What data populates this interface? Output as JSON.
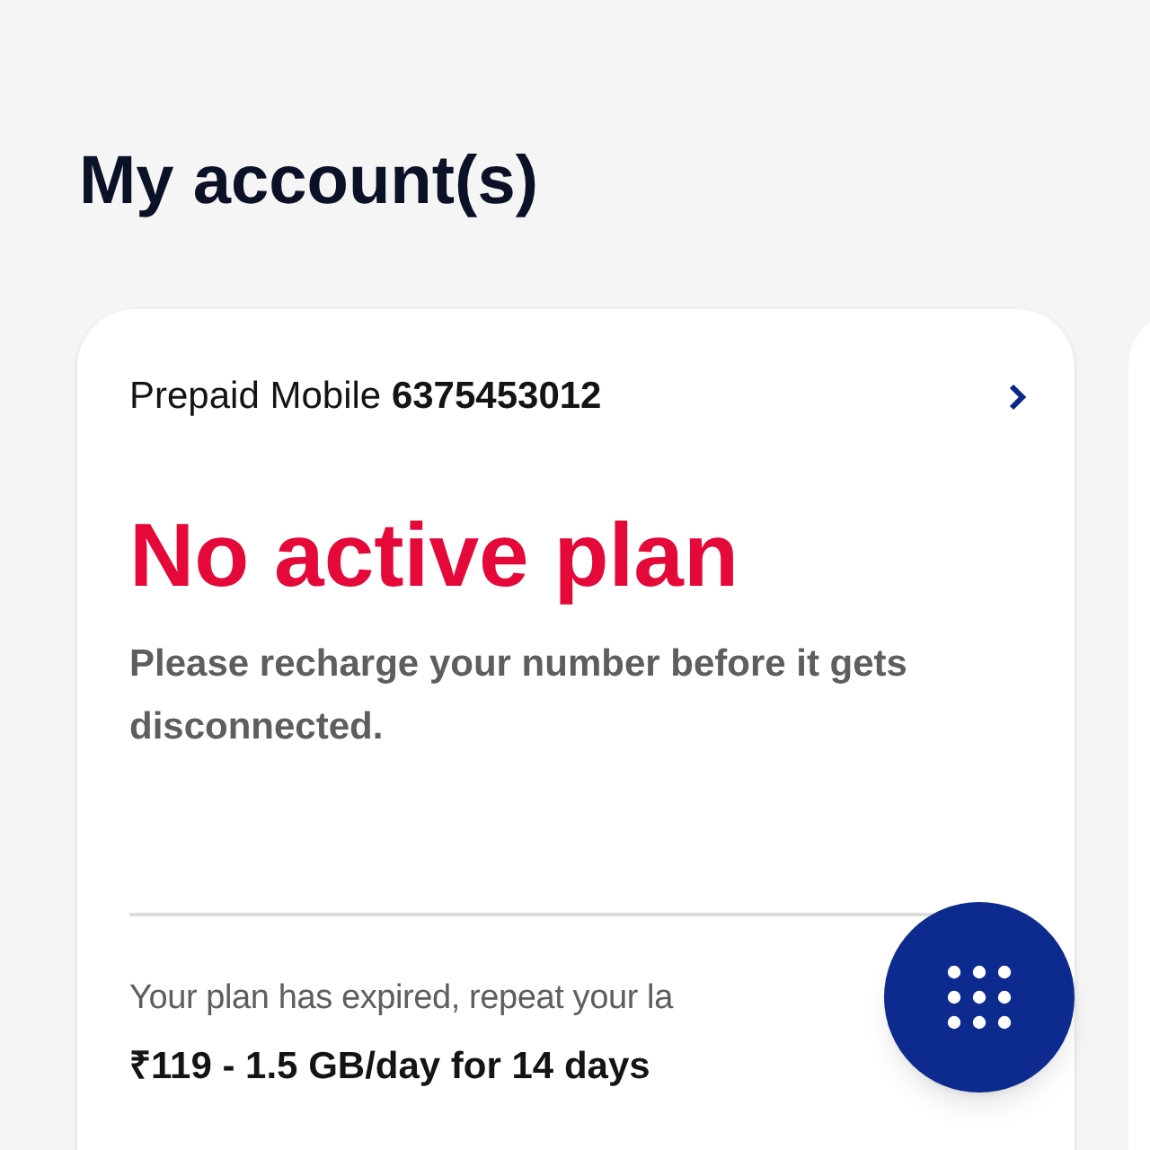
{
  "title": "My account(s)",
  "account": {
    "type": "Prepaid Mobile",
    "number": "6375453012",
    "status": "No active plan",
    "message": "Please recharge your number before it gets disconnected.",
    "expired_text": "Your plan has expired, repeat your la",
    "last_plan": "₹119 - 1.5 GB/day for 14 days"
  }
}
